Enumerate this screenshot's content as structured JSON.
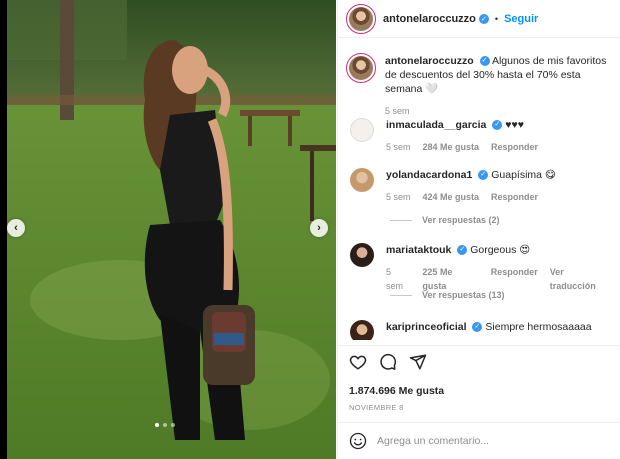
{
  "post": {
    "username": "antonelaroccuzzo",
    "follow_label": "Seguir",
    "separator": "•"
  },
  "caption": {
    "username": "antonelaroccuzzo",
    "text": "Algunos de mis favoritos de descuentos del 30% hasta el 70% esta semana 🤍",
    "time": "5 sem"
  },
  "comments": [
    {
      "username": "inmaculada__garcia",
      "text": "♥♥♥",
      "time": "5 sem",
      "likes": "284 Me gusta",
      "reply": "Responder",
      "translate": ""
    },
    {
      "username": "yolandacardona1",
      "text": "Guapísima 😋",
      "time": "5 sem",
      "likes": "424 Me gusta",
      "reply": "Responder",
      "translate": "",
      "replies": "Ver respuestas (2)"
    },
    {
      "username": "mariataktouk",
      "text": "Gorgeous 😍",
      "time": "5 sem",
      "likes": "225 Me gusta",
      "reply": "Responder",
      "translate": "Ver traducción",
      "replies": "Ver respuestas (13)"
    },
    {
      "username": "kariprinceoficial",
      "text": "Siempre hermosaaaaa",
      "time": "",
      "likes": "",
      "reply": "",
      "translate": ""
    }
  ],
  "engagement": {
    "likes": "1.874.696 Me gusta",
    "date": "NOVIEMBRE 8"
  },
  "composer": {
    "placeholder": "Agrega un comentario..."
  },
  "carousel": {
    "prev": "‹",
    "next": "›",
    "total_slides": 3,
    "active_slide": 1
  },
  "colors": {
    "accent": "#0095f6",
    "verified": "#3897f0",
    "muted": "#8e8e8e"
  },
  "icons": [
    "heart-icon",
    "comment-icon",
    "share-icon",
    "emoji-icon",
    "verified-badge-icon"
  ]
}
